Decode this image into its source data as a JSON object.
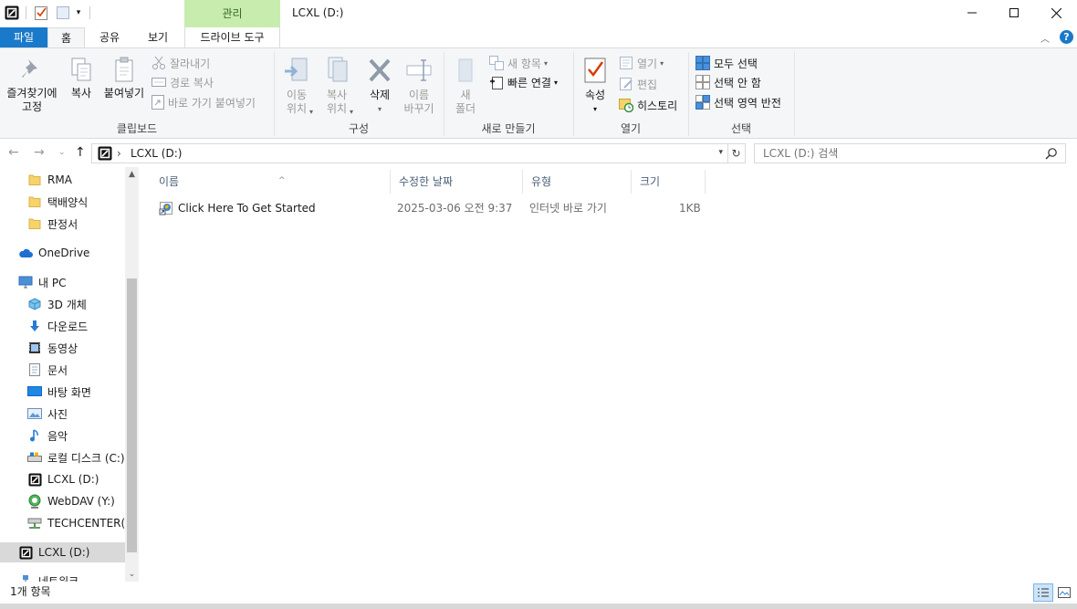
{
  "window": {
    "title": "LCXL (D:)",
    "context_tab": "관리",
    "minimize_glyph": "—",
    "maximize_glyph": "☐",
    "close_glyph": "✕"
  },
  "tabs": {
    "file": "파일",
    "home": "홈",
    "share": "공유",
    "view": "보기",
    "drive_tools": "드라이브 도구"
  },
  "ribbon": {
    "clipboard": {
      "label": "클립보드",
      "pin": "즐겨찾기에\n고정",
      "copy": "복사",
      "paste": "붙여넣기",
      "cut": "잘라내기",
      "copy_path": "경로 복사",
      "paste_shortcut": "바로 가기 붙여넣기"
    },
    "organize": {
      "label": "구성",
      "move_to": "이동\n위치",
      "copy_to": "복사\n위치",
      "delete": "삭제",
      "rename": "이름\n바꾸기"
    },
    "new": {
      "label": "새로 만들기",
      "new_folder": "새\n폴더",
      "new_item": "새 항목",
      "easy_access": "빠른 연결"
    },
    "open": {
      "label": "열기",
      "properties": "속성",
      "open": "열기",
      "edit": "편집",
      "history": "히스토리"
    },
    "select": {
      "label": "선택",
      "select_all": "모두 선택",
      "select_none": "선택 안 함",
      "invert": "선택 영역 반전"
    }
  },
  "address": {
    "path": "LCXL (D:)",
    "separator": "›",
    "search_placeholder": "LCXL (D:) 검색"
  },
  "nav_pane": {
    "items": [
      {
        "label": "RMA",
        "icon": "folder-icon"
      },
      {
        "label": "택배양식",
        "icon": "folder-icon"
      },
      {
        "label": "판정서",
        "icon": "folder-icon"
      },
      {
        "label": "OneDrive",
        "icon": "cloud-icon"
      },
      {
        "label": "내 PC",
        "icon": "computer-icon"
      },
      {
        "label": "3D 개체",
        "icon": "cube-icon"
      },
      {
        "label": "다운로드",
        "icon": "download-icon"
      },
      {
        "label": "동영상",
        "icon": "video-icon"
      },
      {
        "label": "문서",
        "icon": "document-icon"
      },
      {
        "label": "바탕 화면",
        "icon": "desktop-icon"
      },
      {
        "label": "사진",
        "icon": "pictures-icon"
      },
      {
        "label": "음악",
        "icon": "music-icon"
      },
      {
        "label": "로컬 디스크 (C:)",
        "icon": "disk-icon"
      },
      {
        "label": "LCXL (D:)",
        "icon": "drive-icon"
      },
      {
        "label": "WebDAV (Y:)",
        "icon": "network-drive-icon"
      },
      {
        "label": "TECHCENTER(₩",
        "icon": "network-share-icon"
      },
      {
        "label": "LCXL (D:)",
        "icon": "drive-icon"
      },
      {
        "label": "네트워크",
        "icon": "network-icon"
      }
    ]
  },
  "columns": {
    "name": "이름",
    "modified": "수정한 날짜",
    "type": "유형",
    "size": "크기"
  },
  "files": [
    {
      "name": "Click Here To Get Started",
      "modified": "2025-03-06 오전 9:37",
      "type": "인터넷 바로 가기",
      "size": "1KB"
    }
  ],
  "status": {
    "count": "1개 항목"
  },
  "colors": {
    "file_tab": "#1979ca",
    "manage_tab": "#c7ecae",
    "selection": "#d9d9d9",
    "column_text": "#4c607a",
    "ribbon_bg": "#f5f6f7"
  }
}
